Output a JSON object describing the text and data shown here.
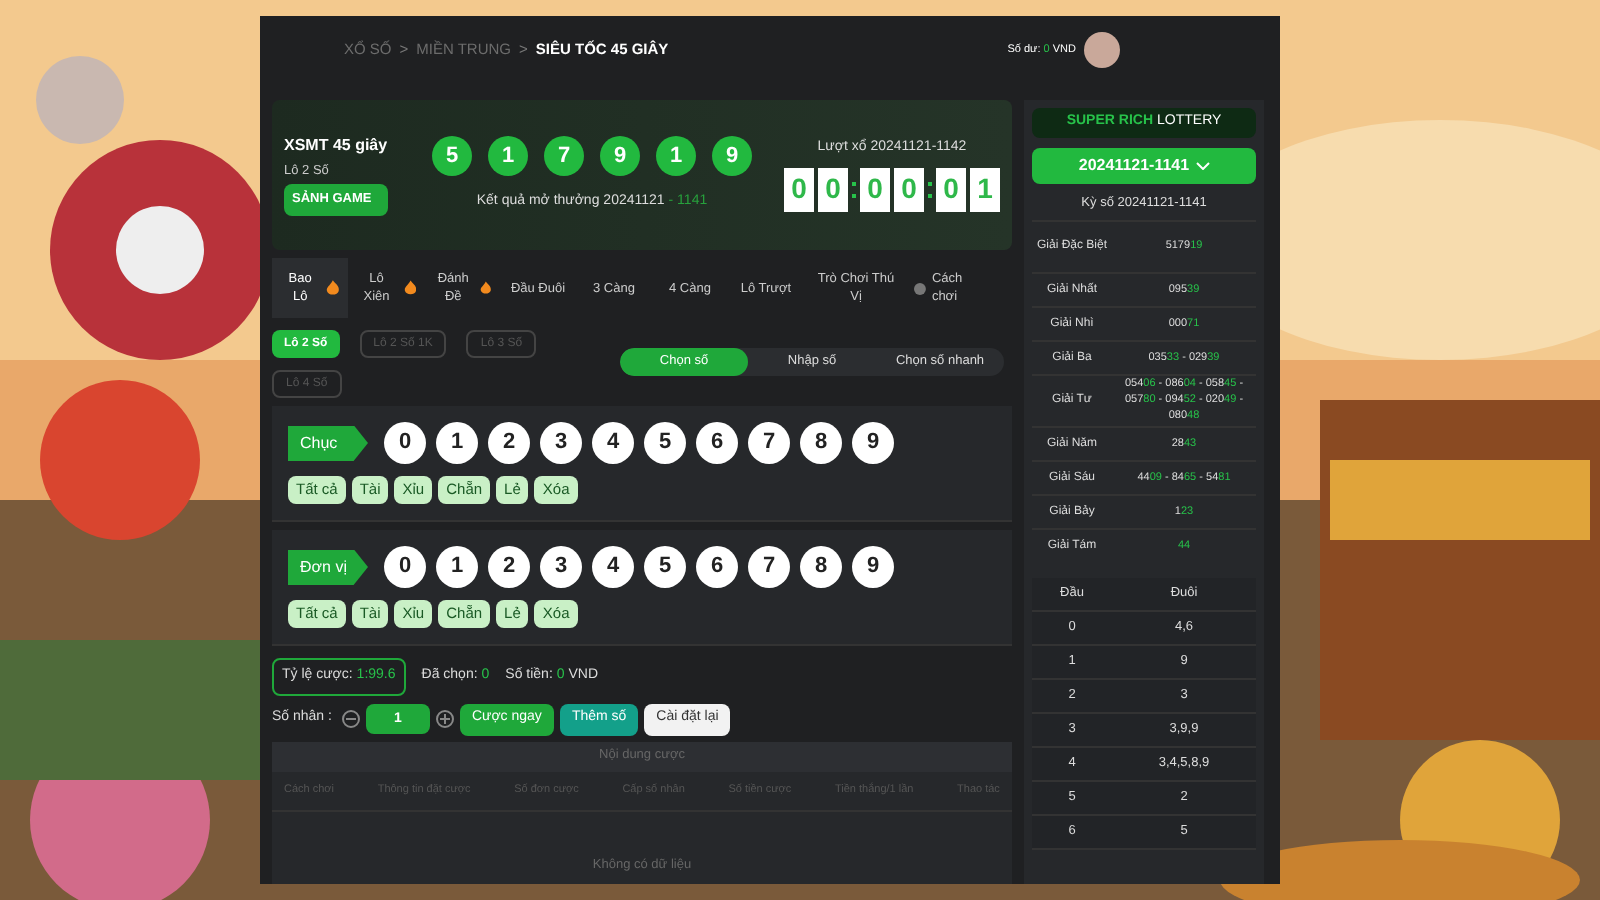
{
  "breadcrumb": [
    {
      "label": "XỔ SỐ",
      "current": false
    },
    {
      "label": "MIỀN TRUNG",
      "current": false
    },
    {
      "label": "SIÊU TỐC 45 GIÂY",
      "current": true
    }
  ],
  "breadcrumb_separator": ">",
  "balance": {
    "label": "Số dư:",
    "amount": "0",
    "currency": "VND"
  },
  "game": {
    "title": "XSMT 45 giây",
    "subtitle": "Lô 2 Số",
    "lobby_button": "SẢNH GAME"
  },
  "result_balls": [
    "5",
    "1",
    "7",
    "9",
    "1",
    "9"
  ],
  "result": {
    "label": "Kết quả mở thưởng",
    "date": "20241121",
    "separator": "-",
    "round": "1141"
  },
  "next_draw": {
    "label": "Lượt xổ",
    "round": "20241121-1142",
    "countdown": [
      [
        "0",
        "0"
      ],
      [
        "0",
        "0"
      ],
      [
        "0",
        "1"
      ]
    ]
  },
  "tabs": [
    {
      "label": "Bao Lô",
      "hot": true,
      "selected": true
    },
    {
      "label": "Lô Xiên",
      "hot": true,
      "selected": false
    },
    {
      "label": "Đánh Đề",
      "hot": true,
      "selected": false
    },
    {
      "label": "Đầu Đuôi",
      "hot": false,
      "selected": false
    },
    {
      "label": "3 Càng",
      "hot": false,
      "selected": false
    },
    {
      "label": "4 Càng",
      "hot": false,
      "selected": false
    },
    {
      "label": "Lô Trượt",
      "hot": false,
      "selected": false
    },
    {
      "label": "Trò Chơi Thú Vị",
      "hot": false,
      "selected": false
    }
  ],
  "help_link": "Cách chơi",
  "sub_tabs": [
    {
      "label": "Lô 2 Số",
      "selected": true
    },
    {
      "label": "Lô 2 Số 1K",
      "selected": false
    },
    {
      "label": "Lô 3 Số",
      "selected": false
    },
    {
      "label": "Lô 4 Số",
      "selected": false
    }
  ],
  "modes": [
    {
      "label": "Chọn số",
      "selected": true
    },
    {
      "label": "Nhập số",
      "selected": false
    },
    {
      "label": "Chọn số nhanh",
      "selected": false
    }
  ],
  "pickers": [
    {
      "label": "Chục",
      "digits": [
        "0",
        "1",
        "2",
        "3",
        "4",
        "5",
        "6",
        "7",
        "8",
        "9"
      ],
      "quick": [
        "Tất cả",
        "Tài",
        "Xỉu",
        "Chẵn",
        "Lẻ",
        "Xóa"
      ]
    },
    {
      "label": "Đơn vị",
      "digits": [
        "0",
        "1",
        "2",
        "3",
        "4",
        "5",
        "6",
        "7",
        "8",
        "9"
      ],
      "quick": [
        "Tất cả",
        "Tài",
        "Xỉu",
        "Chẵn",
        "Lẻ",
        "Xóa"
      ]
    }
  ],
  "bet_info": {
    "odds_label": "Tỷ lệ cược:",
    "odds": "1:99.6",
    "chosen_label": "Đã chọn:",
    "chosen": "0",
    "amount_label": "Số tiền:",
    "amount": "0",
    "currency": "VND"
  },
  "multiplier": {
    "label": "Số nhân :",
    "value": "1"
  },
  "actions": [
    {
      "label": "Cược ngay",
      "kind": "primary"
    },
    {
      "label": "Thêm số",
      "kind": "teal"
    },
    {
      "label": "Cài đặt lại",
      "kind": "light"
    }
  ],
  "bet_table": {
    "title": "Nội dung cược",
    "columns": [
      "Cách chơi",
      "Thông tin đặt cược",
      "Số đơn cược",
      "Cấp số nhân",
      "Số tiền cược",
      "Tiền thắng/1 lần",
      "Thao tác"
    ],
    "empty": "Không có dữ liệu"
  },
  "brand": {
    "green_part": "SUPER RICH",
    "white_part": "LOTTERY"
  },
  "period_select": "20241121-1141",
  "period_label": "Kỳ số 20241121-1141",
  "prizes": [
    {
      "name": "Giải Đặc Biệt",
      "numbers": [
        {
          "head": "5179",
          "tail": "19"
        }
      ]
    },
    {
      "name": "Giải Nhất",
      "numbers": [
        {
          "head": "095",
          "tail": "39"
        }
      ]
    },
    {
      "name": "Giải Nhì",
      "numbers": [
        {
          "head": "000",
          "tail": "71"
        }
      ]
    },
    {
      "name": "Giải Ba",
      "numbers": [
        {
          "head": "035",
          "tail": "33"
        },
        {
          "head": "029",
          "tail": "39"
        }
      ]
    },
    {
      "name": "Giải Tư",
      "numbers": [
        {
          "head": "054",
          "tail": "06"
        },
        {
          "head": "086",
          "tail": "04"
        },
        {
          "head": "058",
          "tail": "45"
        },
        {
          "head": "057",
          "tail": "80"
        },
        {
          "head": "094",
          "tail": "52"
        },
        {
          "head": "020",
          "tail": "49"
        },
        {
          "head": "080",
          "tail": "48"
        }
      ]
    },
    {
      "name": "Giải Năm",
      "numbers": [
        {
          "head": "28",
          "tail": "43"
        }
      ]
    },
    {
      "name": "Giải Sáu",
      "numbers": [
        {
          "head": "44",
          "tail": "09"
        },
        {
          "head": "84",
          "tail": "65"
        },
        {
          "head": "54",
          "tail": "81"
        }
      ]
    },
    {
      "name": "Giải Bảy",
      "numbers": [
        {
          "head": "1",
          "tail": "23"
        }
      ]
    },
    {
      "name": "Giải Tám",
      "numbers": [
        {
          "tail": "44"
        }
      ]
    }
  ],
  "number_separator": "-",
  "head_tail": {
    "columns": [
      "Đầu",
      "Đuôi"
    ],
    "rows": [
      [
        "0",
        "4,6"
      ],
      [
        "1",
        "9"
      ],
      [
        "2",
        "3"
      ],
      [
        "3",
        "3,9,9"
      ],
      [
        "4",
        "3,4,5,8,9"
      ],
      [
        "5",
        "2"
      ],
      [
        "6",
        "5"
      ]
    ]
  }
}
